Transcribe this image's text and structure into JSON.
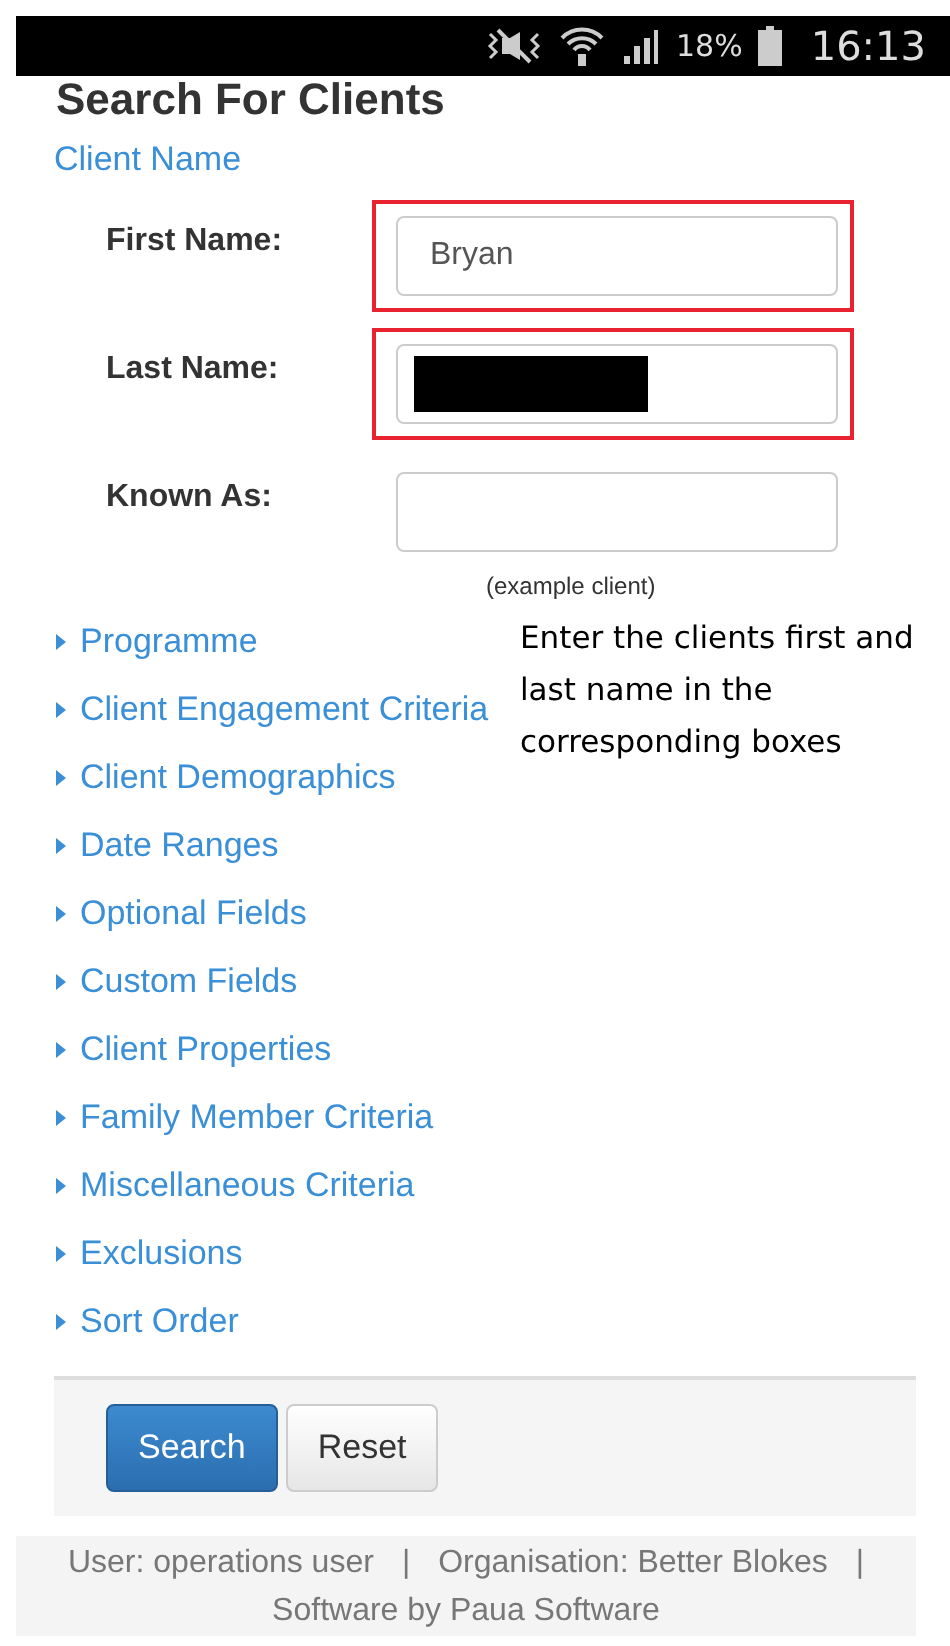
{
  "status_bar": {
    "battery": "18%",
    "time": "16:13"
  },
  "title": "Search For Clients",
  "section_heading": "Client Name",
  "fields": [
    {
      "label": "First Name:",
      "value": "Bryan",
      "highlighted": true,
      "redacted": false
    },
    {
      "label": "Last Name:",
      "highlighted": true,
      "redacted": true
    },
    {
      "label": "Known As:",
      "highlighted": false,
      "redacted": false
    }
  ],
  "hint": "(example client)",
  "annotation": "Enter the clients first and last name in the corresponding boxes",
  "sections": [
    {
      "label": "Programme",
      "expanded": false
    },
    {
      "label": "Client Engagement Criteria",
      "expanded": false
    },
    {
      "label": "Client Demographics",
      "expanded": false
    },
    {
      "label": "Date Ranges",
      "expanded": false
    },
    {
      "label": "Optional Fields",
      "expanded": false
    },
    {
      "label": "Custom Fields",
      "expanded": false
    },
    {
      "label": "Client Properties",
      "expanded": false
    },
    {
      "label": "Family Member Criteria",
      "expanded": false
    },
    {
      "label": "Miscellaneous Criteria",
      "expanded": false
    },
    {
      "label": "Exclusions",
      "expanded": false
    },
    {
      "label": "Sort Order",
      "expanded": false
    }
  ],
  "buttons": [
    {
      "label": "Search",
      "kind": "primary"
    },
    {
      "label": "Reset",
      "kind": "default"
    }
  ],
  "footer": [
    "User: operations user",
    "|",
    "Organisation: Better Blokes",
    "|",
    "Software by Paua Software"
  ]
}
